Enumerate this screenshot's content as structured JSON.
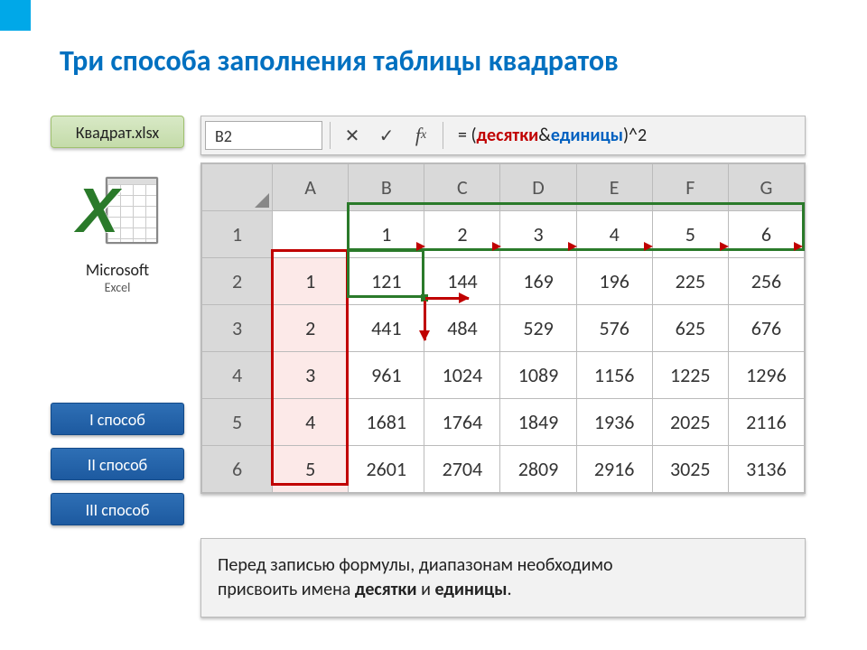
{
  "title": "Три способа заполнения таблицы квадратов",
  "file_chip": "Квадрат.xlsx",
  "app": {
    "name": "Microsoft",
    "sub": "Excel"
  },
  "buttons": {
    "b1": "I способ",
    "b2": "II способ",
    "b3": "III способ"
  },
  "formula_bar": {
    "cell_ref": "B2",
    "eq": "= (",
    "red": "десятки",
    "amp": " & ",
    "blue": "единицы",
    "tail": ")^2"
  },
  "grid": {
    "cols": [
      "A",
      "B",
      "C",
      "D",
      "E",
      "F",
      "G"
    ],
    "rows": [
      "1",
      "2",
      "3",
      "4",
      "5",
      "6"
    ],
    "row1": [
      "",
      "1",
      "2",
      "3",
      "4",
      "5",
      "6"
    ],
    "colA": [
      "1",
      "2",
      "3",
      "4",
      "5"
    ],
    "data": [
      [
        "121",
        "144",
        "169",
        "196",
        "225",
        "256"
      ],
      [
        "441",
        "484",
        "529",
        "576",
        "625",
        "676"
      ],
      [
        "961",
        "1024",
        "1089",
        "1156",
        "1225",
        "1296"
      ],
      [
        "1681",
        "1764",
        "1849",
        "1936",
        "2025",
        "2116"
      ],
      [
        "2601",
        "2704",
        "2809",
        "2916",
        "3025",
        "3136"
      ]
    ]
  },
  "note": {
    "line1": "Перед записью формулы, диапазонам необходимо",
    "line2a": "присвоить имена ",
    "bold1": "десятки",
    "and": " и ",
    "bold2": "единицы",
    "dot": "."
  }
}
